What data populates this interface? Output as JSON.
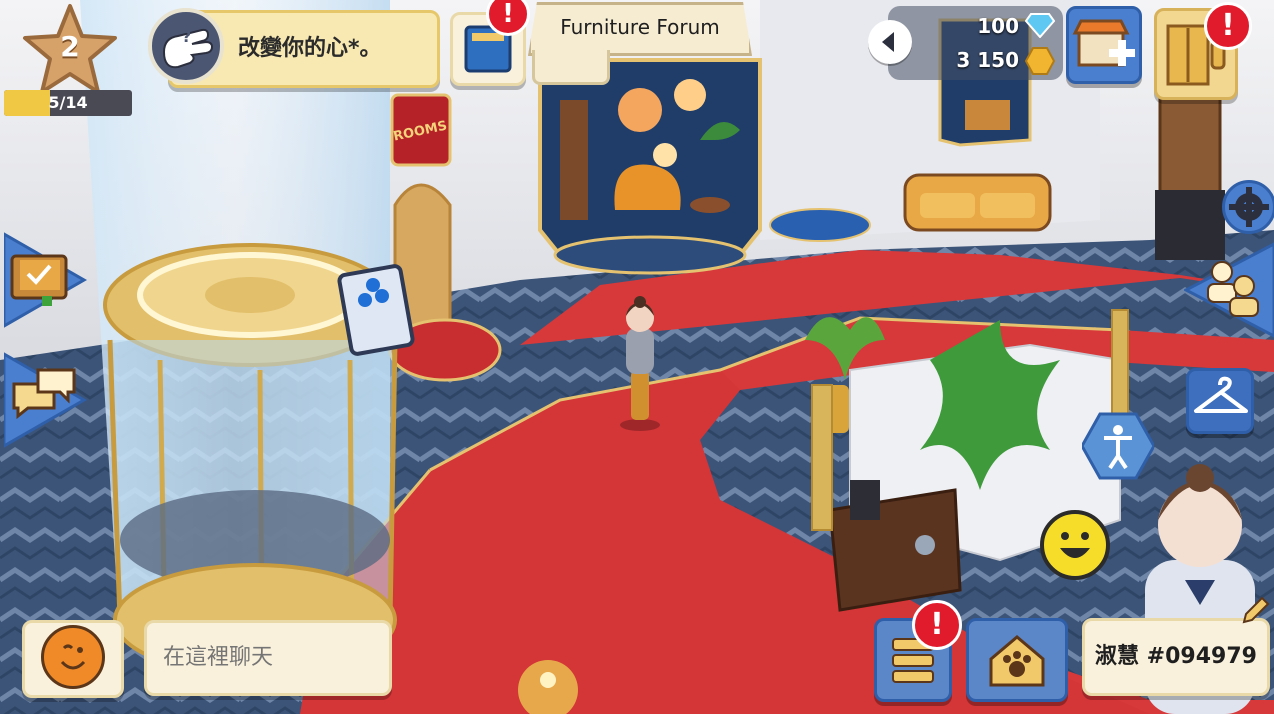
{
  "player": {
    "level": "2",
    "xp_progress": "5/14",
    "xp_fraction": 0.357
  },
  "quest": {
    "text": "改變你的心*。"
  },
  "location": {
    "title": "Furniture Forum"
  },
  "currency": {
    "gems": "100",
    "coins": "3 150"
  },
  "chat": {
    "placeholder": "在這裡聊天"
  },
  "profile": {
    "name": "淑慧 #094979"
  },
  "colors": {
    "carpet": "#d7393b",
    "floor": "#3c5478",
    "gold": "#e2bf6a",
    "hud_bg": "#faf1dc",
    "badge_red": "#e21b2c",
    "button_blue": "#4a7fd0"
  },
  "icons": {
    "level_star": "star-icon",
    "quest": "pointing-hand-icon",
    "gem": "diamond-icon",
    "coin": "coin-icon",
    "shop": "shop-add-icon",
    "elevator": "elevator-icon",
    "settings": "gear-icon",
    "friends": "friends-icon",
    "wardrobe": "hanger-icon",
    "pose": "body-pose-icon",
    "emote": "smiley-icon",
    "pet": "paw-house-icon",
    "menu": "hamburger-menu-icon",
    "journal": "task-book-icon",
    "chat_bubble": "speech-bubbles-icon",
    "edit": "pencil-icon"
  }
}
